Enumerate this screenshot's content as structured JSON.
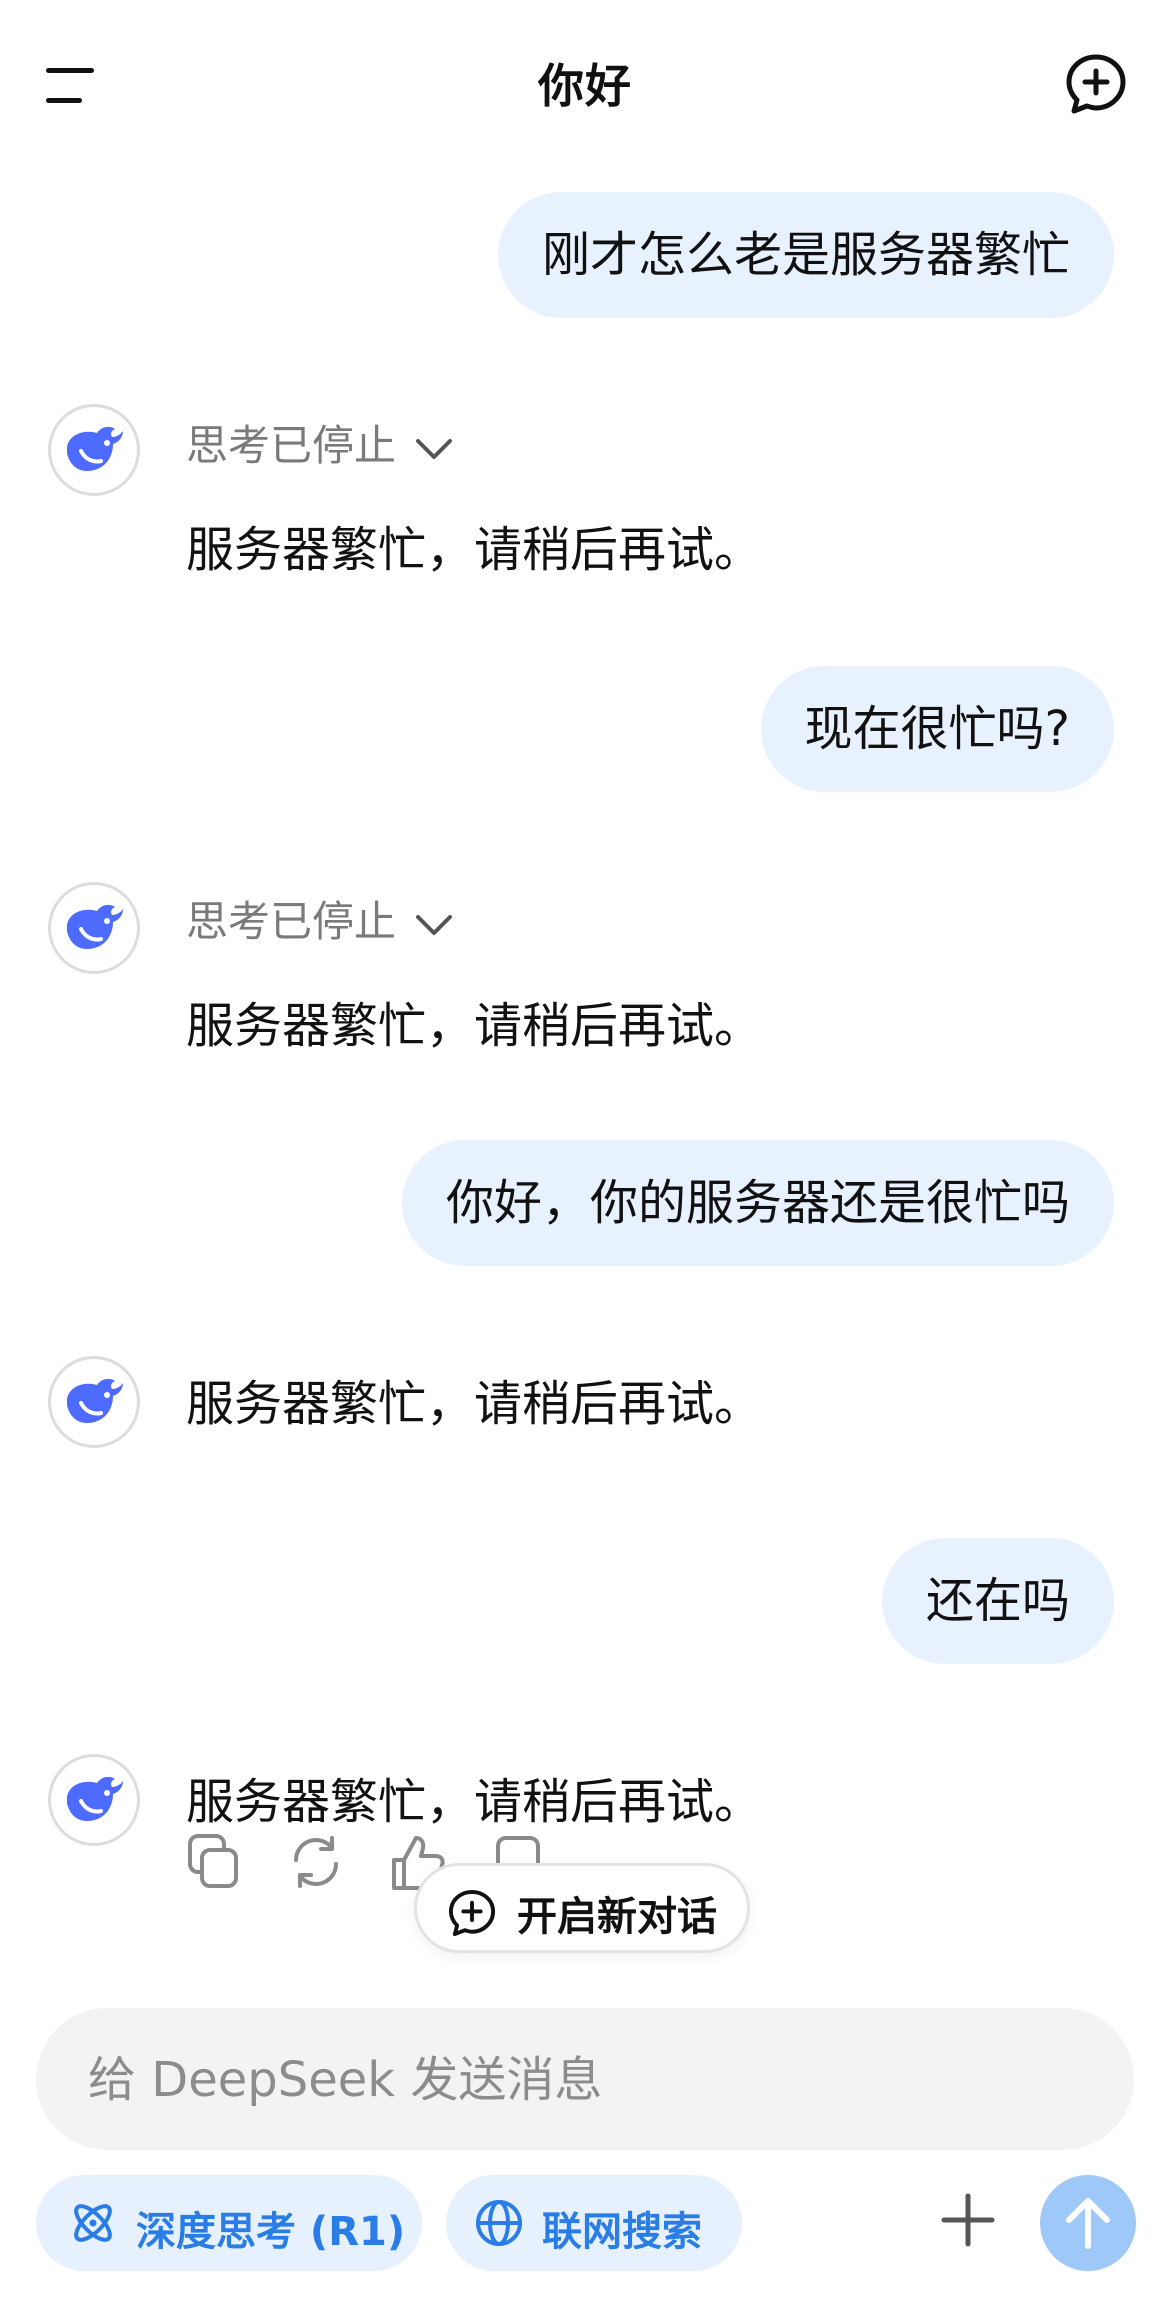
{
  "header": {
    "title": "你好"
  },
  "conversation": {
    "thinking_label": "思考已停止",
    "messages": [
      {
        "role": "user",
        "text": "刚才怎么老是服务器繁忙"
      },
      {
        "role": "assistant",
        "text": "服务器繁忙，请稍后再试。"
      },
      {
        "role": "user",
        "text": "现在很忙吗?"
      },
      {
        "role": "assistant",
        "text": "服务器繁忙，请稍后再试。"
      },
      {
        "role": "user",
        "text": "你好，你的服务器还是很忙吗"
      },
      {
        "role": "assistant",
        "text": "服务器繁忙，请稍后再试。"
      },
      {
        "role": "user",
        "text": "还在吗"
      },
      {
        "role": "assistant",
        "text": "服务器繁忙，请稍后再试。"
      }
    ]
  },
  "message_actions": [
    "copy-icon",
    "regenerate-icon",
    "thumbs-up-icon",
    "thumbs-down-icon"
  ],
  "new_conversation_label": "开启新对话",
  "composer": {
    "placeholder": "给 DeepSeek 发送消息",
    "deep_think_label": "深度思考 (R1)",
    "web_search_label": "联网搜索"
  },
  "colors": {
    "user_bubble": "#e8f2fe",
    "accent": "#2b7de6",
    "chip_bg": "#e6f1fd",
    "send_disabled": "#9ec8f8",
    "logo_blue": "#4d6bfe"
  }
}
